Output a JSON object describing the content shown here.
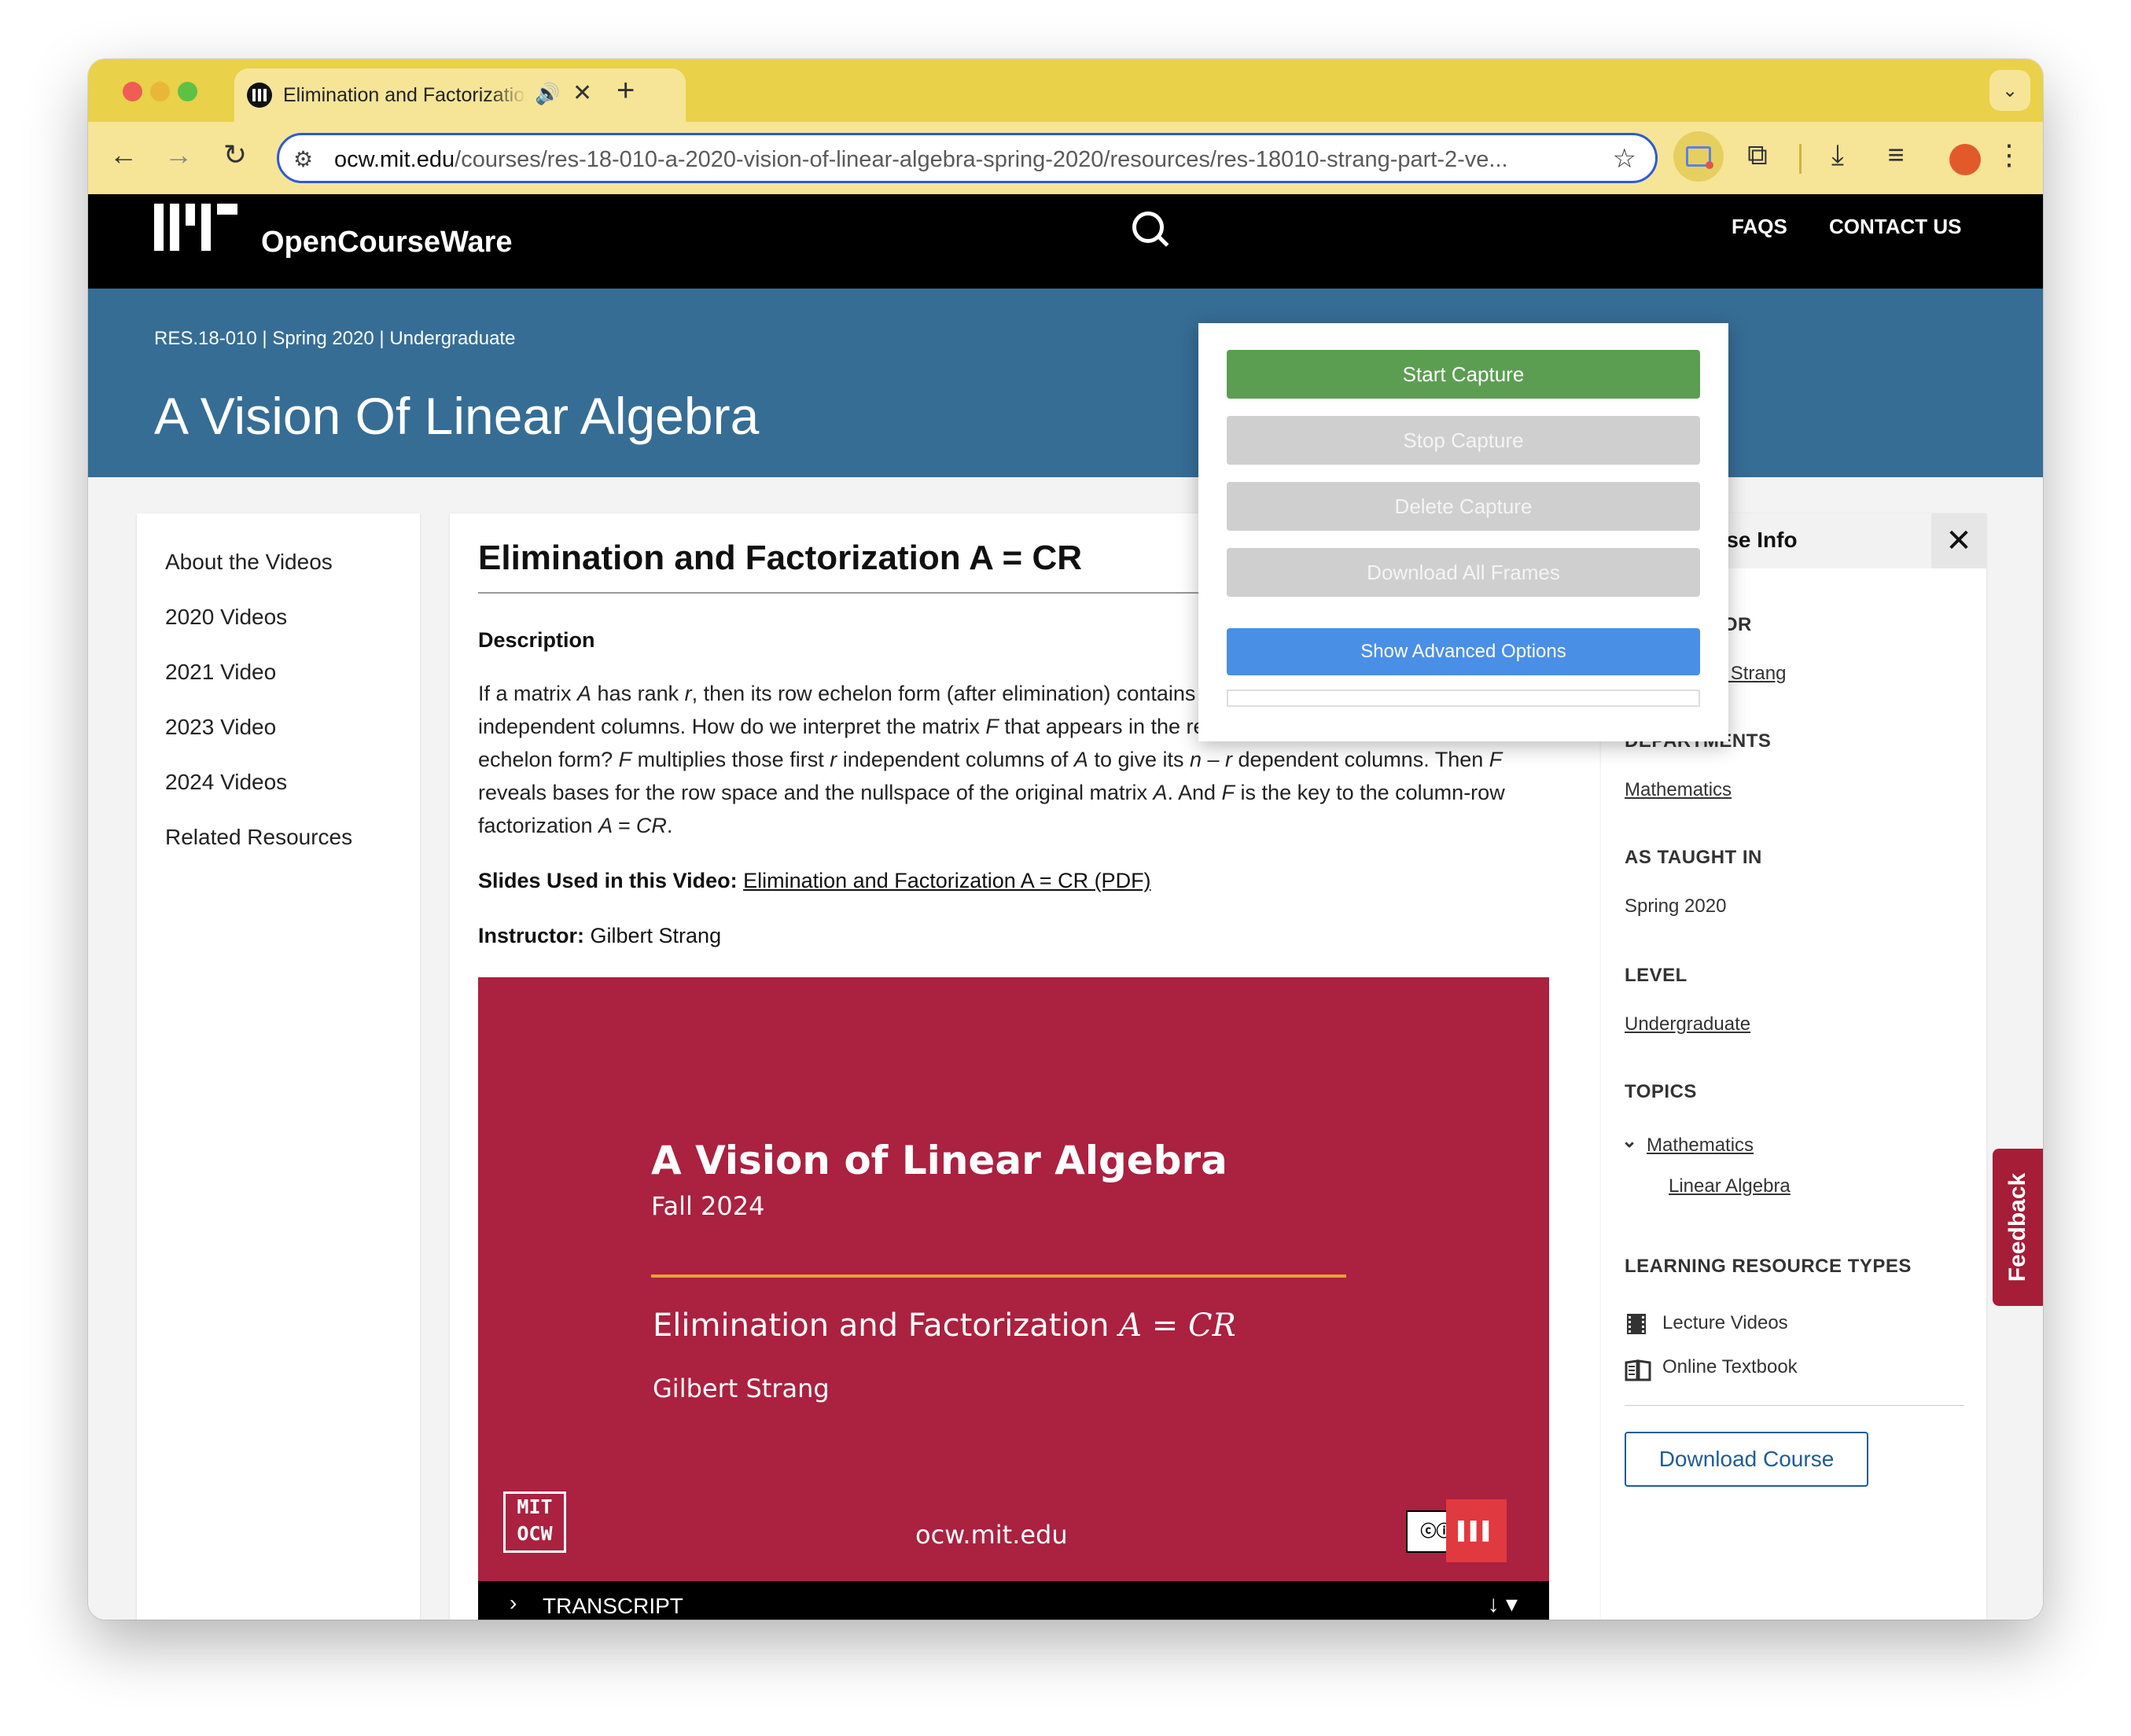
{
  "browser": {
    "tab_title": "Elimination and Factorization A = CR",
    "new_tab_label": "+",
    "url_domain": "ocw.mit.edu",
    "url_path": "/courses/res-18-010-a-2020-vision-of-linear-algebra-spring-2020/resources/res-18010-strang-part-2-ve..."
  },
  "site": {
    "name": "OpenCourseWare",
    "nav": {
      "faqs": "FAQS",
      "contact": "CONTACT US"
    }
  },
  "course": {
    "meta": "RES.18-010 | Spring 2020 | Undergraduate",
    "title": "A Vision Of Linear Algebra"
  },
  "left_nav": {
    "items": [
      "About the Videos",
      "2020 Videos",
      "2021 Video",
      "2023 Video",
      "2024 Videos",
      "Related Resources"
    ]
  },
  "resource": {
    "title": "Elimination and Factorization A = CR",
    "description_heading": "Description",
    "description": {
      "s1": "If a matrix ",
      "A": "A",
      "s2": " has rank ",
      "r": "r",
      "s3": ", then its row echelon form (after elimination) contains the identity matrix in its first ",
      "s4": " independent columns. How do we interpret the matrix ",
      "F": "F",
      "s5": " that appears in the remaining ",
      "nr": "n – r",
      "s6": " columns of that echelon form? ",
      "s7": " multiplies those first ",
      "s8": " independent columns of ",
      "s9": " to give its ",
      "s10": " dependent columns. Then ",
      "s11": " reveals bases for the row space and the nullspace of the original matrix ",
      "s12": ". And ",
      "s13": " is the key to the column-row factorization ",
      "ACR": "A = CR",
      "end": "."
    },
    "slides_label": "Slides Used in this Video:",
    "slides_link": "Elimination and Factorization A = CR (PDF)",
    "instructor_label": "Instructor:",
    "instructor_name": "Gilbert Strang"
  },
  "video": {
    "title": "A Vision of Linear Algebra",
    "subtitle": "Fall 2024",
    "lecture_text": "Elimination and Factorization ",
    "lecture_math": "A = CR",
    "author": "Gilbert Strang",
    "logo_line1": "MIT",
    "logo_line2": "OCW",
    "url": "ocw.mit.edu",
    "transcript_label": "TRANSCRIPT"
  },
  "course_info": {
    "heading": "Course Info",
    "instructor_label": "INSTRUCTOR",
    "instructor": "Prof. Gilbert Strang",
    "departments_label": "DEPARTMENTS",
    "department": "Mathematics",
    "taught_label": "AS TAUGHT IN",
    "taught": "Spring 2020",
    "level_label": "LEVEL",
    "level": "Undergraduate",
    "topics_label": "TOPICS",
    "topic": "Mathematics",
    "subtopic": "Linear Algebra",
    "lrt_label": "LEARNING RESOURCE TYPES",
    "lrt": [
      "Lecture Videos",
      "Online Textbook"
    ],
    "download": "Download Course"
  },
  "feedback": "Feedback",
  "extension_popup": {
    "start": "Start Capture",
    "stop": "Stop Capture",
    "delete": "Delete Capture",
    "download_all": "Download All Frames",
    "advanced": "Show Advanced Options"
  },
  "colors": {
    "chrome_accent": "#e9d14a",
    "omnibox_focus": "#2c5ad6",
    "course_banner": "#366d95",
    "video_bg": "#ab2140",
    "start_btn": "#5b9e52",
    "advanced_btn": "#4a8fe6",
    "feedback_tab": "#a51d36"
  }
}
